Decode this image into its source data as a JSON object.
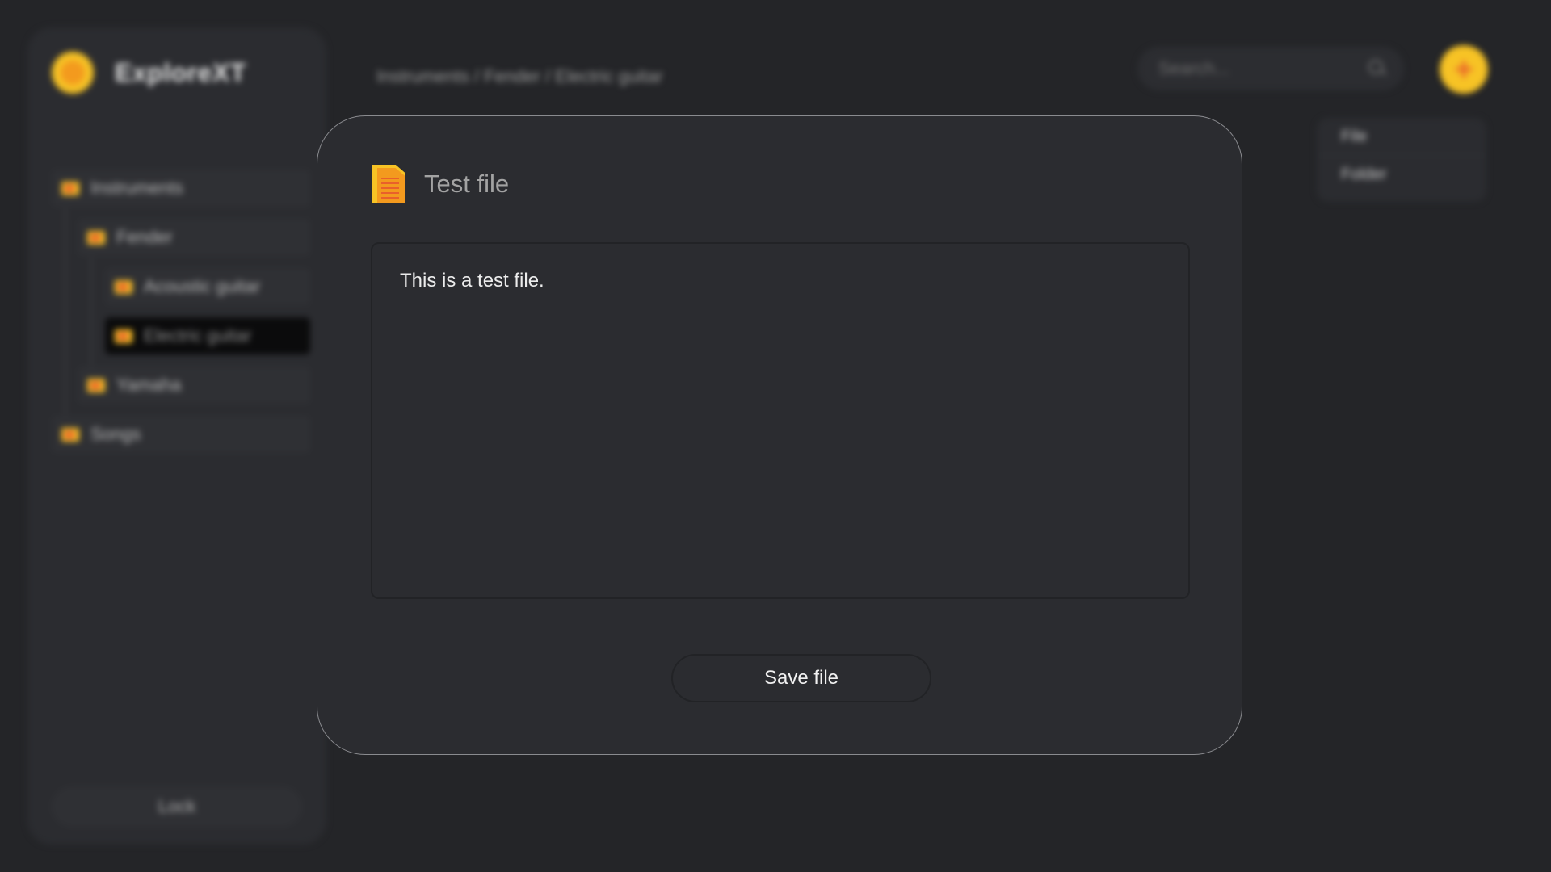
{
  "app": {
    "name": "ExploreXT"
  },
  "sidebar": {
    "tree": [
      {
        "label": "Instruments"
      },
      {
        "label": "Fender"
      },
      {
        "label": "Acoustic guitar"
      },
      {
        "label": "Electric guitar"
      },
      {
        "label": "Yamaha"
      },
      {
        "label": "Songs"
      }
    ],
    "lock_label": "Lock"
  },
  "header": {
    "breadcrumb": "Instruments / Fender / Electric guitar",
    "search_placeholder": "Search...",
    "add_label": "+"
  },
  "new_menu": {
    "items": [
      {
        "label": "File"
      },
      {
        "label": "Folder"
      }
    ]
  },
  "modal": {
    "title": "Test file",
    "content": "This is a test file.",
    "save_label": "Save file"
  },
  "colors": {
    "accent": "#f7c325",
    "accent_secondary": "#e9612a",
    "background": "#242528",
    "panel": "#2b2c30"
  }
}
